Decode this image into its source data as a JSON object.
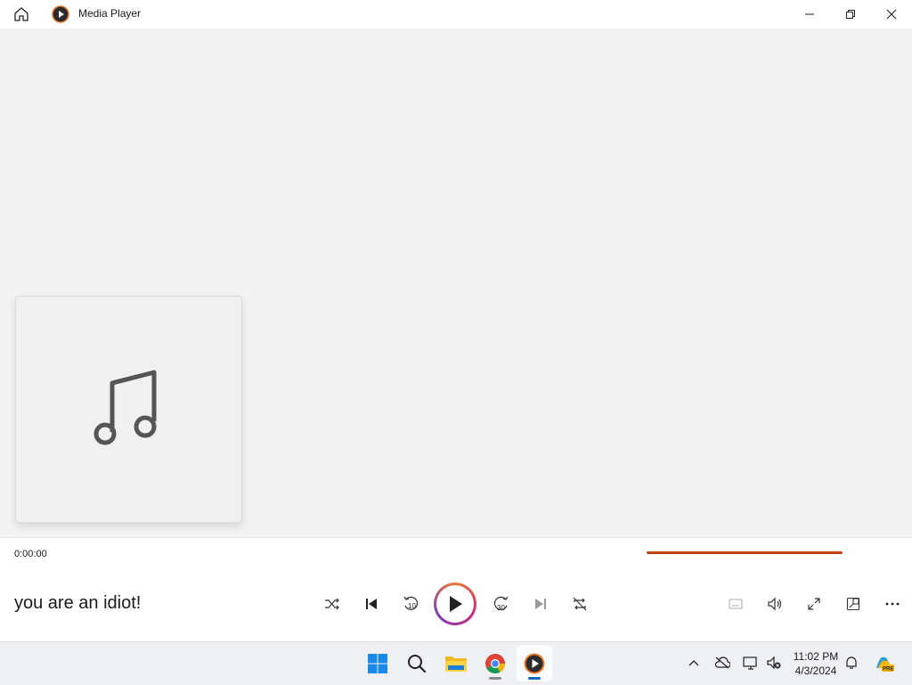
{
  "titlebar": {
    "app_title": "Media Player",
    "home_icon": "home-icon",
    "app_icon": "media-player-icon",
    "minimize_icon": "minimize-icon",
    "restore_icon": "restore-icon",
    "close_icon": "close-icon"
  },
  "album": {
    "placeholder_icon": "music-note-icon"
  },
  "playback": {
    "current_time": "0:00:00",
    "track_title": "you are an idiot!",
    "progress": 0,
    "accent_color": "#c0430f"
  },
  "control_icons": [
    "shuffle-icon",
    "previous-icon",
    "skip-back-10-icon",
    "play-icon",
    "skip-forward-30-icon",
    "next-icon",
    "repeat-icon"
  ],
  "skip_back_label": "10",
  "skip_forward_label": "30",
  "right_icons": [
    "captions-icon",
    "volume-icon",
    "fullscreen-icon",
    "miniplayer-icon",
    "more-icon"
  ],
  "taskbar": {
    "apps": [
      "start-icon",
      "search-icon",
      "file-explorer-icon",
      "chrome-icon",
      "media-player-icon"
    ],
    "clock_time": "11:02 PM",
    "clock_date": "4/3/2024",
    "tray": [
      "chevron-up-icon",
      "onedrive-icon",
      "network-icon",
      "volume-muted-icon",
      "notification-icon",
      "copilot-icon"
    ],
    "copilot_badge": "PRE"
  }
}
